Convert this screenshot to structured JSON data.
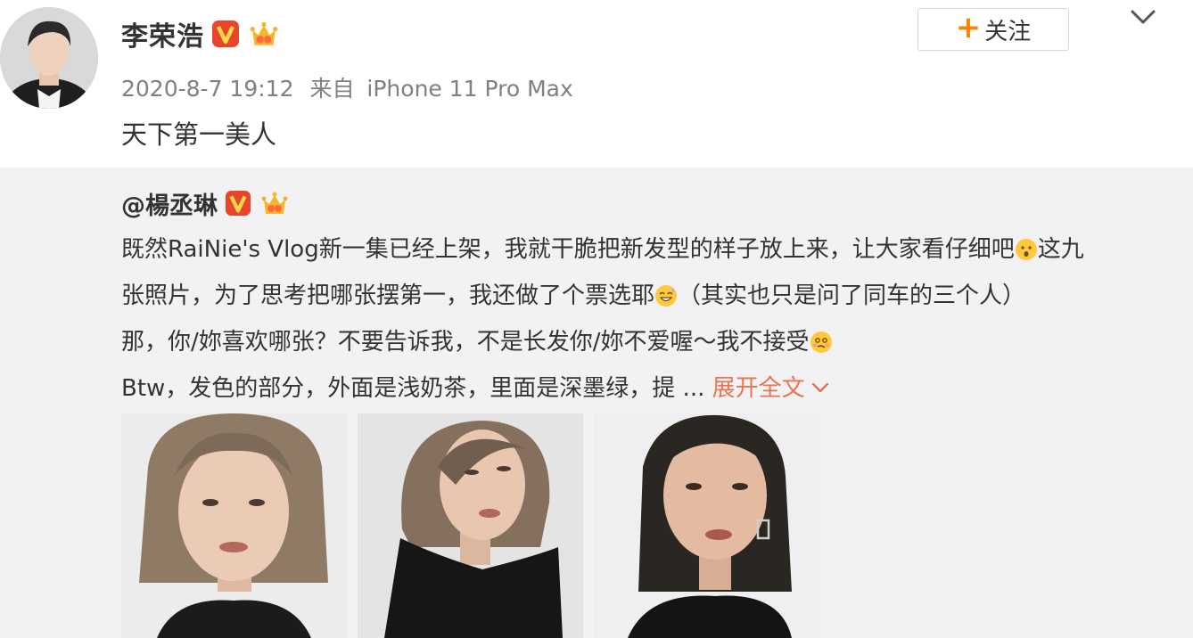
{
  "post": {
    "author": "李荣浩",
    "follow_label": "关注",
    "timestamp": "2020-8-7 19:12",
    "source_prefix": "来自",
    "source_device": "iPhone 11 Pro Max",
    "text": "天下第一美人"
  },
  "repost": {
    "author": "@楊丞琳",
    "lines": {
      "l1a": "既然RaiNie's Vlog新一集已经上架，我就干脆把新发型的样子放上来，让大家看仔细吧",
      "l1b": "这九",
      "l2a": "张照片，为了思考把哪张摆第一，我还做了个票选耶",
      "l2b": "（其实也只是问了同车的三个人）",
      "l3a": "那，你/妳喜欢哪张？不要告诉我，不是长发你/妳不爱喔～我不接受",
      "l4a": "Btw，发色的部分，外面是浅奶茶，里面是深墨绿，提 ...",
      "expand": "展开全文"
    }
  },
  "colors": {
    "accent_orange": "#ff8200",
    "verified_red": "#e8452d",
    "link_orange": "#eb7350",
    "repost_bg": "#f2f2f5"
  },
  "icons": {
    "verified": "verified-v-badge",
    "membership": "crown-membership-badge",
    "menu": "chevron-down-icon"
  }
}
